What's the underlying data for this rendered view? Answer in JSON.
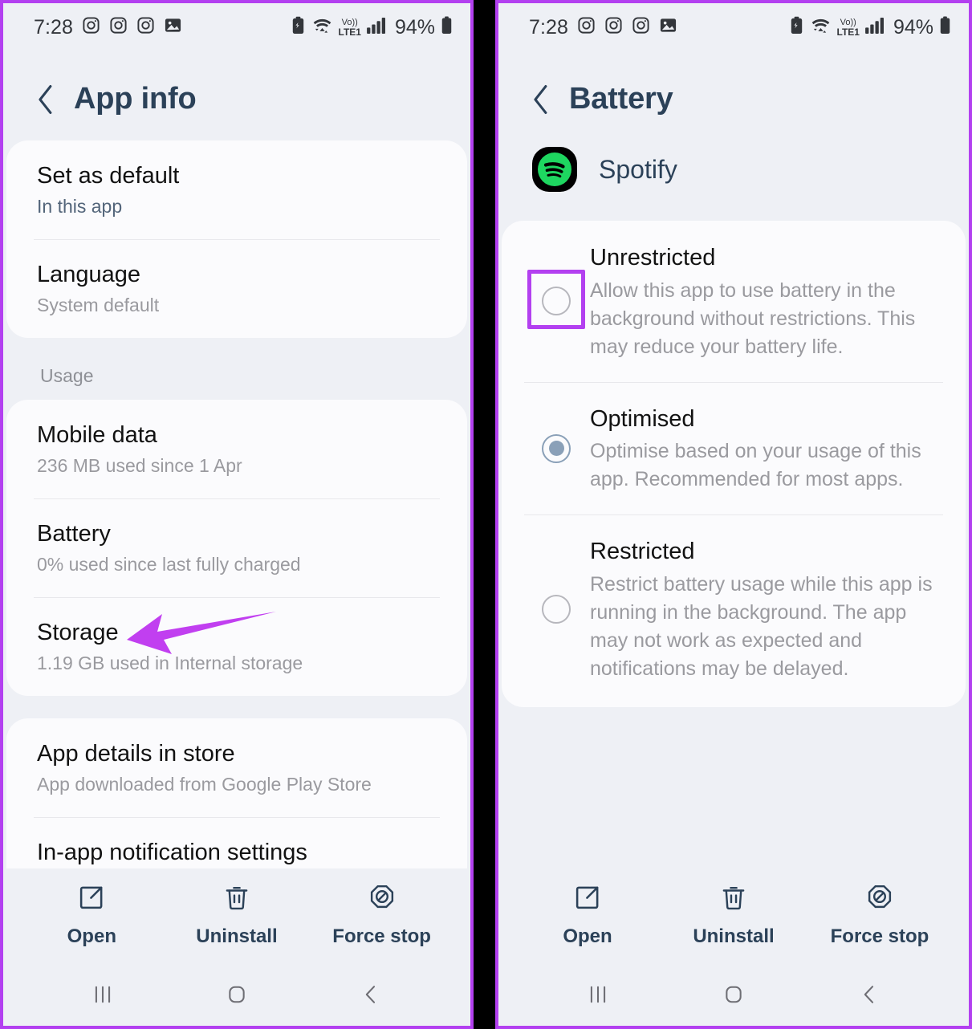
{
  "statusbar": {
    "time": "7:28",
    "battery_percent": "94%",
    "network_label": "LTE1",
    "volte_label": "Vo))",
    "icons": [
      "instagram-icon",
      "instagram-icon",
      "instagram-icon",
      "photos-icon",
      "battery-saver-icon",
      "wifi-icon",
      "volte-icon",
      "signal-icon",
      "battery-icon"
    ]
  },
  "left": {
    "header": {
      "title": "App info",
      "back": "back-chevron"
    },
    "card_top": {
      "rows": [
        {
          "title": "Set as default",
          "sub": "In this app"
        },
        {
          "title": "Language",
          "sub": "System default"
        }
      ]
    },
    "usage_label": "Usage",
    "card_usage": {
      "rows": [
        {
          "title": "Mobile data",
          "sub": "236 MB used since 1 Apr"
        },
        {
          "title": "Battery",
          "sub": "0% used since last fully charged"
        },
        {
          "title": "Storage",
          "sub": "1.19 GB used in Internal storage"
        }
      ]
    },
    "card_store": {
      "rows": [
        {
          "title": "App details in store",
          "sub": "App downloaded from Google Play Store"
        },
        {
          "title": "In-app notification settings",
          "sub": ""
        }
      ]
    },
    "annotation": {
      "type": "arrow",
      "points_to": "Battery",
      "color": "#c13ff0"
    }
  },
  "right": {
    "header": {
      "title": "Battery",
      "back": "back-chevron"
    },
    "app": {
      "name": "Spotify",
      "icon": "spotify-icon"
    },
    "options": [
      {
        "title": "Unrestricted",
        "desc": "Allow this app to use battery in the background without restrictions. This may reduce your battery life.",
        "selected": false,
        "highlighted": true
      },
      {
        "title": "Optimised",
        "desc": "Optimise based on your usage of this app. Recommended for most apps.",
        "selected": true,
        "highlighted": false
      },
      {
        "title": "Restricted",
        "desc": "Restrict battery usage while this app is running in the background. The app may not work as expected and notifications may be delayed.",
        "selected": false,
        "highlighted": false
      }
    ]
  },
  "actionbar": {
    "open": "Open",
    "uninstall": "Uninstall",
    "force_stop": "Force stop"
  },
  "navbar": {
    "recents": "recents-icon",
    "home": "home-icon",
    "back": "back-icon"
  },
  "colors": {
    "accent_purple": "#b340f0",
    "arrow_purple": "#c13ff0",
    "title_blue": "#2b4158",
    "radio_selected": "#8aa0b8",
    "spotify_green": "#1ed760",
    "page_bg": "#eef0f5",
    "card_bg": "#fbfbfd"
  }
}
